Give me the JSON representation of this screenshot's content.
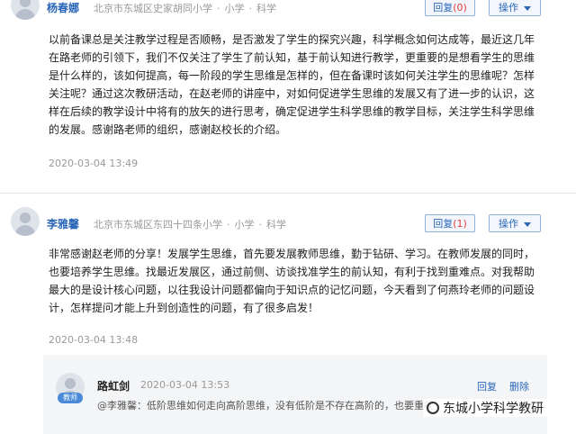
{
  "post1": {
    "user": "杨春娜",
    "meta": [
      "北京市东城区史家胡同小学",
      "小学",
      "科学"
    ],
    "reply_label": "回复",
    "reply_count": "(0)",
    "action_label": "操作",
    "content": [
      "以前备课总是关注教学过程是否顺畅，是否激发了学生的探究兴趣，科学概念如何达成等，最近这几年",
      "在路老师的引领下，我们不仅关注了学生了前认知，基于前认知进行教学，更重要的是想看学生的思维",
      "是什么样的，该如何提高，每一阶段的学生思维是怎样的，但在备课时该如何关注学生的思维呢？怎样",
      "关注呢？通过这次教研活动，在赵老师的讲座中，对如何促进学生思维的发展又有了进一步的认识，这",
      "样在后续的教学设计中将有的放矢的进行思考，确定促进学生科学思维的教学目标，关注学生科学思维",
      "的发展。感谢路老师的组织，感谢赵校长的介绍。"
    ],
    "time": "2020-03-04 13:49"
  },
  "post2": {
    "user": "李雅馨",
    "meta": [
      "北京市东城区东四十四条小学",
      "小学",
      "科学"
    ],
    "reply_label": "回复",
    "reply_count": "(1)",
    "action_label": "操作",
    "content": [
      "非常感谢赵老师的分享！发展学生思维，首先要发展教师思维，勤于钻研、学习。在教师发展的同时，",
      "也要培养学生思维。找最近发展区，通过前侧、访谈找准学生的前认知，有利于找到重难点。对我帮助",
      "最大的是设计核心问题，以往我设计问题都偏向于知识点的记忆问题，今天看到了何燕玲老师的问题设",
      "计，怎样提问才能上升到创造性的问题，有了很多启发！"
    ],
    "time": "2020-03-04 13:48"
  },
  "reply": {
    "badge": "教师",
    "user": "路虹剑",
    "time": "2020-03-04 13:53",
    "reply_label": "回复",
    "delete_label": "删除",
    "text": "@李雅馨：低阶思维如何走向高阶思维，没有低阶是不存在高阶的，也要重视"
  },
  "watermark": "东城小学科学教研",
  "colors": {
    "link": "#2a66b8",
    "count": "#e23b3b",
    "badge": "#4a8ad8"
  }
}
